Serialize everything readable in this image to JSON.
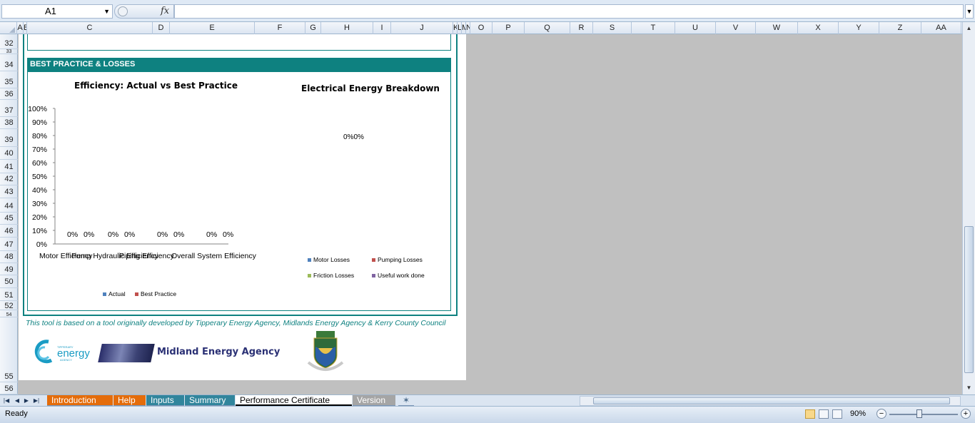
{
  "formula_bar": {
    "name_box": "A1",
    "fx_label": "fx",
    "formula": ""
  },
  "columns": [
    "A",
    "B",
    "C",
    "D",
    "E",
    "F",
    "G",
    "H",
    "I",
    "J",
    "K",
    "L",
    "M",
    "N",
    "O",
    "P",
    "Q",
    "R",
    "S",
    "T",
    "U",
    "V",
    "W",
    "X",
    "Y",
    "Z",
    "AA"
  ],
  "rows": [
    "32",
    "33",
    "34",
    "35",
    "36",
    "37",
    "38",
    "39",
    "40",
    "41",
    "42",
    "43",
    "44",
    "45",
    "46",
    "47",
    "48",
    "49",
    "50",
    "51",
    "52",
    "54",
    "55",
    "56"
  ],
  "sheet": {
    "section_header": "BEST PRACTICE & LOSSES",
    "credit_text": "This tool is based on a tool originally developed by Tipperary Energy Agency, Midlands Energy Agency & Kerry County Council",
    "tea_logo_text": "energy",
    "tea_logo_small": "TIPPERARY",
    "tea_logo_small2": "AGENCY",
    "mea_logo_text": "Midland Energy Agency"
  },
  "chart_data": [
    {
      "type": "bar",
      "title": "Efficiency: Actual vs Best Practice",
      "categories": [
        "Motor Efficiency",
        "Pump Hydraulic Efficiency",
        "Piping Efficiency",
        "Overall System Efficiency"
      ],
      "series": [
        {
          "name": "Actual",
          "values": [
            0,
            0,
            0,
            0
          ],
          "labels": [
            "0%",
            "0%",
            "0%",
            "0%"
          ]
        },
        {
          "name": "Best Practice",
          "values": [
            0,
            0,
            0,
            0
          ],
          "labels": [
            "0%",
            "0%",
            "0%",
            "0%"
          ]
        }
      ],
      "yticks": [
        "0%",
        "10%",
        "20%",
        "30%",
        "40%",
        "50%",
        "60%",
        "70%",
        "80%",
        "90%",
        "100%"
      ],
      "ylim": [
        0,
        1
      ],
      "legend_position": "bottom",
      "colors": {
        "Actual": "#4f81bd",
        "Best Practice": "#c0504d"
      }
    },
    {
      "type": "pie",
      "title": "Electrical Energy Breakdown",
      "categories": [
        "Motor Losses",
        "Pumping Losses",
        "Friction Losses",
        "Useful work done"
      ],
      "values": [
        0,
        0,
        0,
        0
      ],
      "data_label_text": "0%0%",
      "legend_position": "bottom",
      "colors": {
        "Motor Losses": "#4f81bd",
        "Pumping Losses": "#c0504d",
        "Friction Losses": "#9bbb59",
        "Useful work done": "#8064a2"
      }
    }
  ],
  "tabs": [
    {
      "label": "Introduction",
      "color": "#e46c0a",
      "active": false
    },
    {
      "label": "Help",
      "color": "#e46c0a",
      "active": false
    },
    {
      "label": "Inputs",
      "color": "#31859c",
      "active": false
    },
    {
      "label": "Summary",
      "color": "#31859c",
      "active": false
    },
    {
      "label": "Performance Certificate",
      "color": "#ffffff",
      "active": true
    },
    {
      "label": "Version",
      "color": "#a5a5a5",
      "active": false
    }
  ],
  "status_bar": {
    "status": "Ready",
    "zoom": "90%",
    "zoom_fraction": 0.4
  }
}
